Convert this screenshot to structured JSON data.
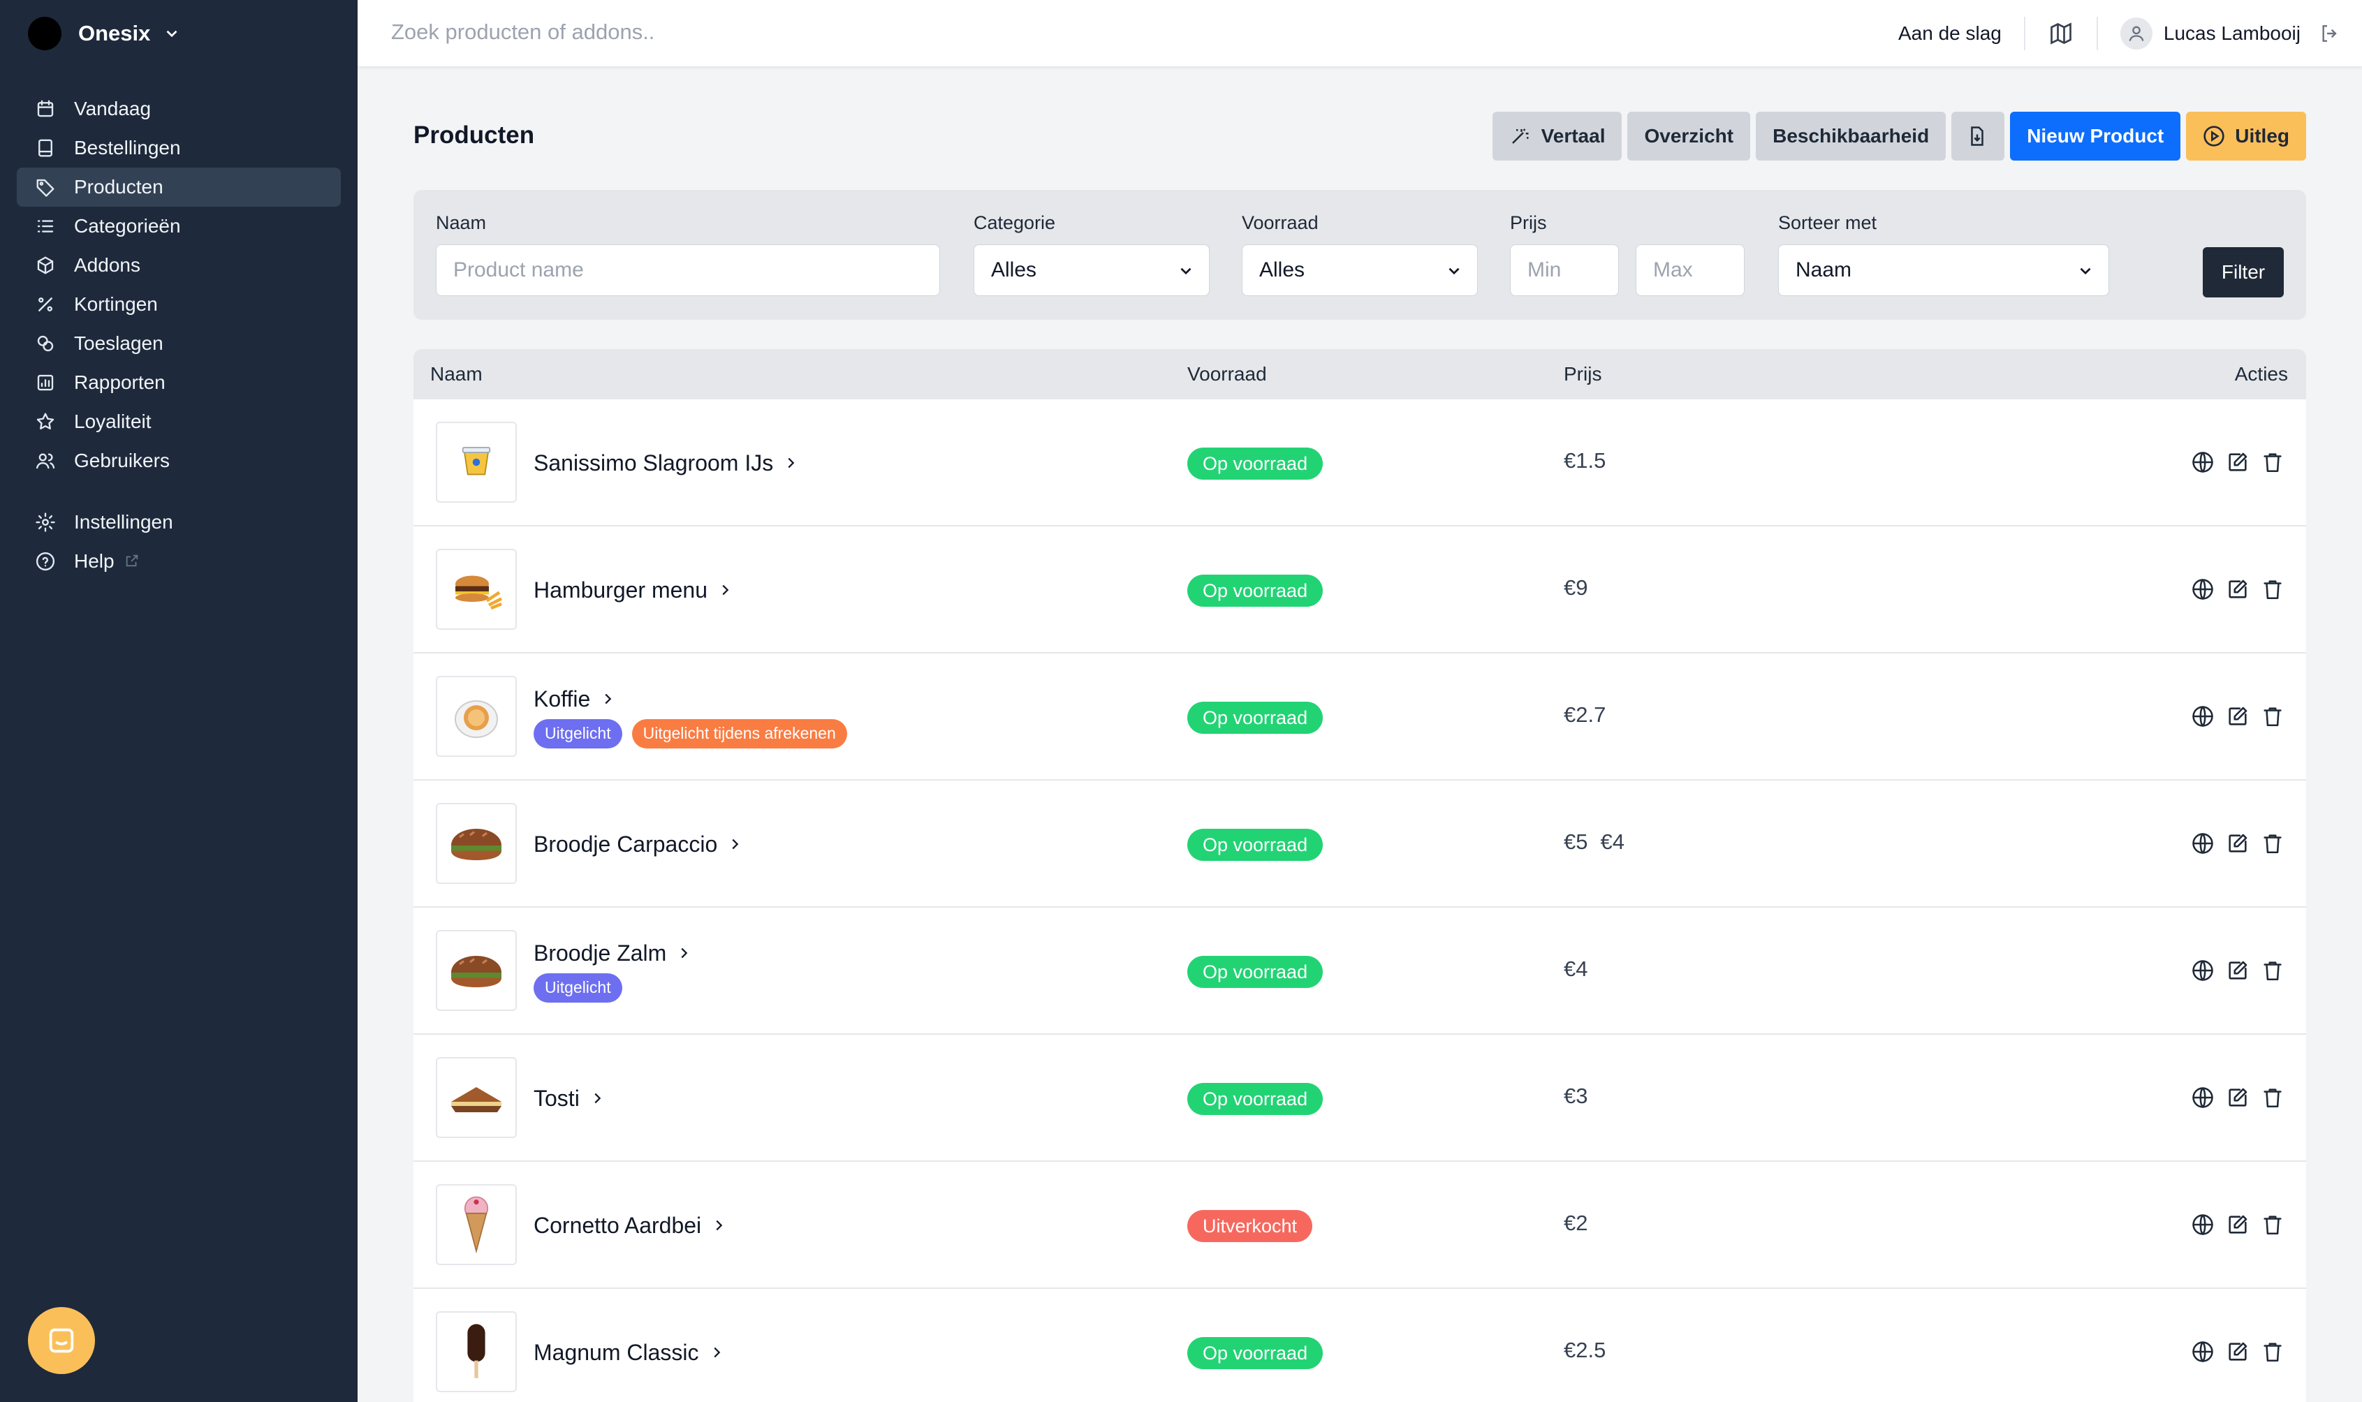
{
  "sidebar": {
    "org_name": "Onesix",
    "items": [
      {
        "label": "Vandaag",
        "icon": "calendar-icon"
      },
      {
        "label": "Bestellingen",
        "icon": "receipt-icon"
      },
      {
        "label": "Producten",
        "icon": "tag-icon",
        "active": true
      },
      {
        "label": "Categorieën",
        "icon": "list-icon"
      },
      {
        "label": "Addons",
        "icon": "cube-icon"
      },
      {
        "label": "Kortingen",
        "icon": "percent-icon"
      },
      {
        "label": "Toeslagen",
        "icon": "coins-icon"
      },
      {
        "label": "Rapporten",
        "icon": "chart-icon"
      },
      {
        "label": "Loyaliteit",
        "icon": "star-icon"
      },
      {
        "label": "Gebruikers",
        "icon": "users-icon"
      }
    ],
    "bottom_items": [
      {
        "label": "Instellingen",
        "icon": "gear-icon"
      },
      {
        "label": "Help",
        "icon": "help-icon"
      }
    ]
  },
  "topbar": {
    "search_placeholder": "Zoek producten of addons..",
    "get_started": "Aan de slag",
    "user_name": "Lucas Lambooij"
  },
  "page": {
    "title": "Producten",
    "actions": {
      "translate": "Vertaal",
      "overview": "Overzicht",
      "availability": "Beschikbaarheid",
      "new_product": "Nieuw Product",
      "explain": "Uitleg"
    }
  },
  "filter": {
    "name_label": "Naam",
    "name_placeholder": "Product name",
    "category_label": "Categorie",
    "category_value": "Alles",
    "stock_label": "Voorraad",
    "stock_value": "Alles",
    "price_label": "Prijs",
    "min_placeholder": "Min",
    "max_placeholder": "Max",
    "sort_label": "Sorteer met",
    "sort_value": "Naam",
    "filter_button": "Filter"
  },
  "table": {
    "headers": {
      "name": "Naam",
      "stock": "Voorraad",
      "price": "Prijs",
      "actions": "Acties"
    },
    "rows": [
      {
        "name": "Sanissimo Slagroom IJs",
        "tags": [],
        "stock": "Op voorraad",
        "in_stock": true,
        "price": "€1.5",
        "sale_price": "",
        "thumb": "ice-cream-tub"
      },
      {
        "name": "Hamburger menu",
        "tags": [],
        "stock": "Op voorraad",
        "in_stock": true,
        "price": "€9",
        "sale_price": "",
        "thumb": "hamburger"
      },
      {
        "name": "Koffie",
        "tags": [
          {
            "label": "Uitgelicht",
            "color": "#6d6ff0"
          },
          {
            "label": "Uitgelicht tijdens afrekenen",
            "color": "#f97c42"
          }
        ],
        "stock": "Op voorraad",
        "in_stock": true,
        "price": "€2.7",
        "sale_price": "",
        "thumb": "coffee"
      },
      {
        "name": "Broodje Carpaccio",
        "tags": [],
        "stock": "Op voorraad",
        "in_stock": true,
        "price": "€5",
        "sale_price": "€4",
        "thumb": "sandwich"
      },
      {
        "name": "Broodje Zalm",
        "tags": [
          {
            "label": "Uitgelicht",
            "color": "#6d6ff0"
          }
        ],
        "stock": "Op voorraad",
        "in_stock": true,
        "price": "€4",
        "sale_price": "",
        "thumb": "sandwich"
      },
      {
        "name": "Tosti",
        "tags": [],
        "stock": "Op voorraad",
        "in_stock": true,
        "price": "€3",
        "sale_price": "",
        "thumb": "toast"
      },
      {
        "name": "Cornetto Aardbei",
        "tags": [],
        "stock": "Uitverkocht",
        "in_stock": false,
        "price": "€2",
        "sale_price": "",
        "thumb": "cone"
      },
      {
        "name": "Magnum Classic",
        "tags": [],
        "stock": "Op voorraad",
        "in_stock": true,
        "price": "€2.5",
        "sale_price": "",
        "thumb": "popsicle"
      }
    ]
  },
  "colors": {
    "sidebar_bg": "#1e293b",
    "primary": "#0d6efd",
    "accent_yellow": "#fbbf5a",
    "in_stock": "#22d374",
    "sold_out": "#f6685e"
  }
}
